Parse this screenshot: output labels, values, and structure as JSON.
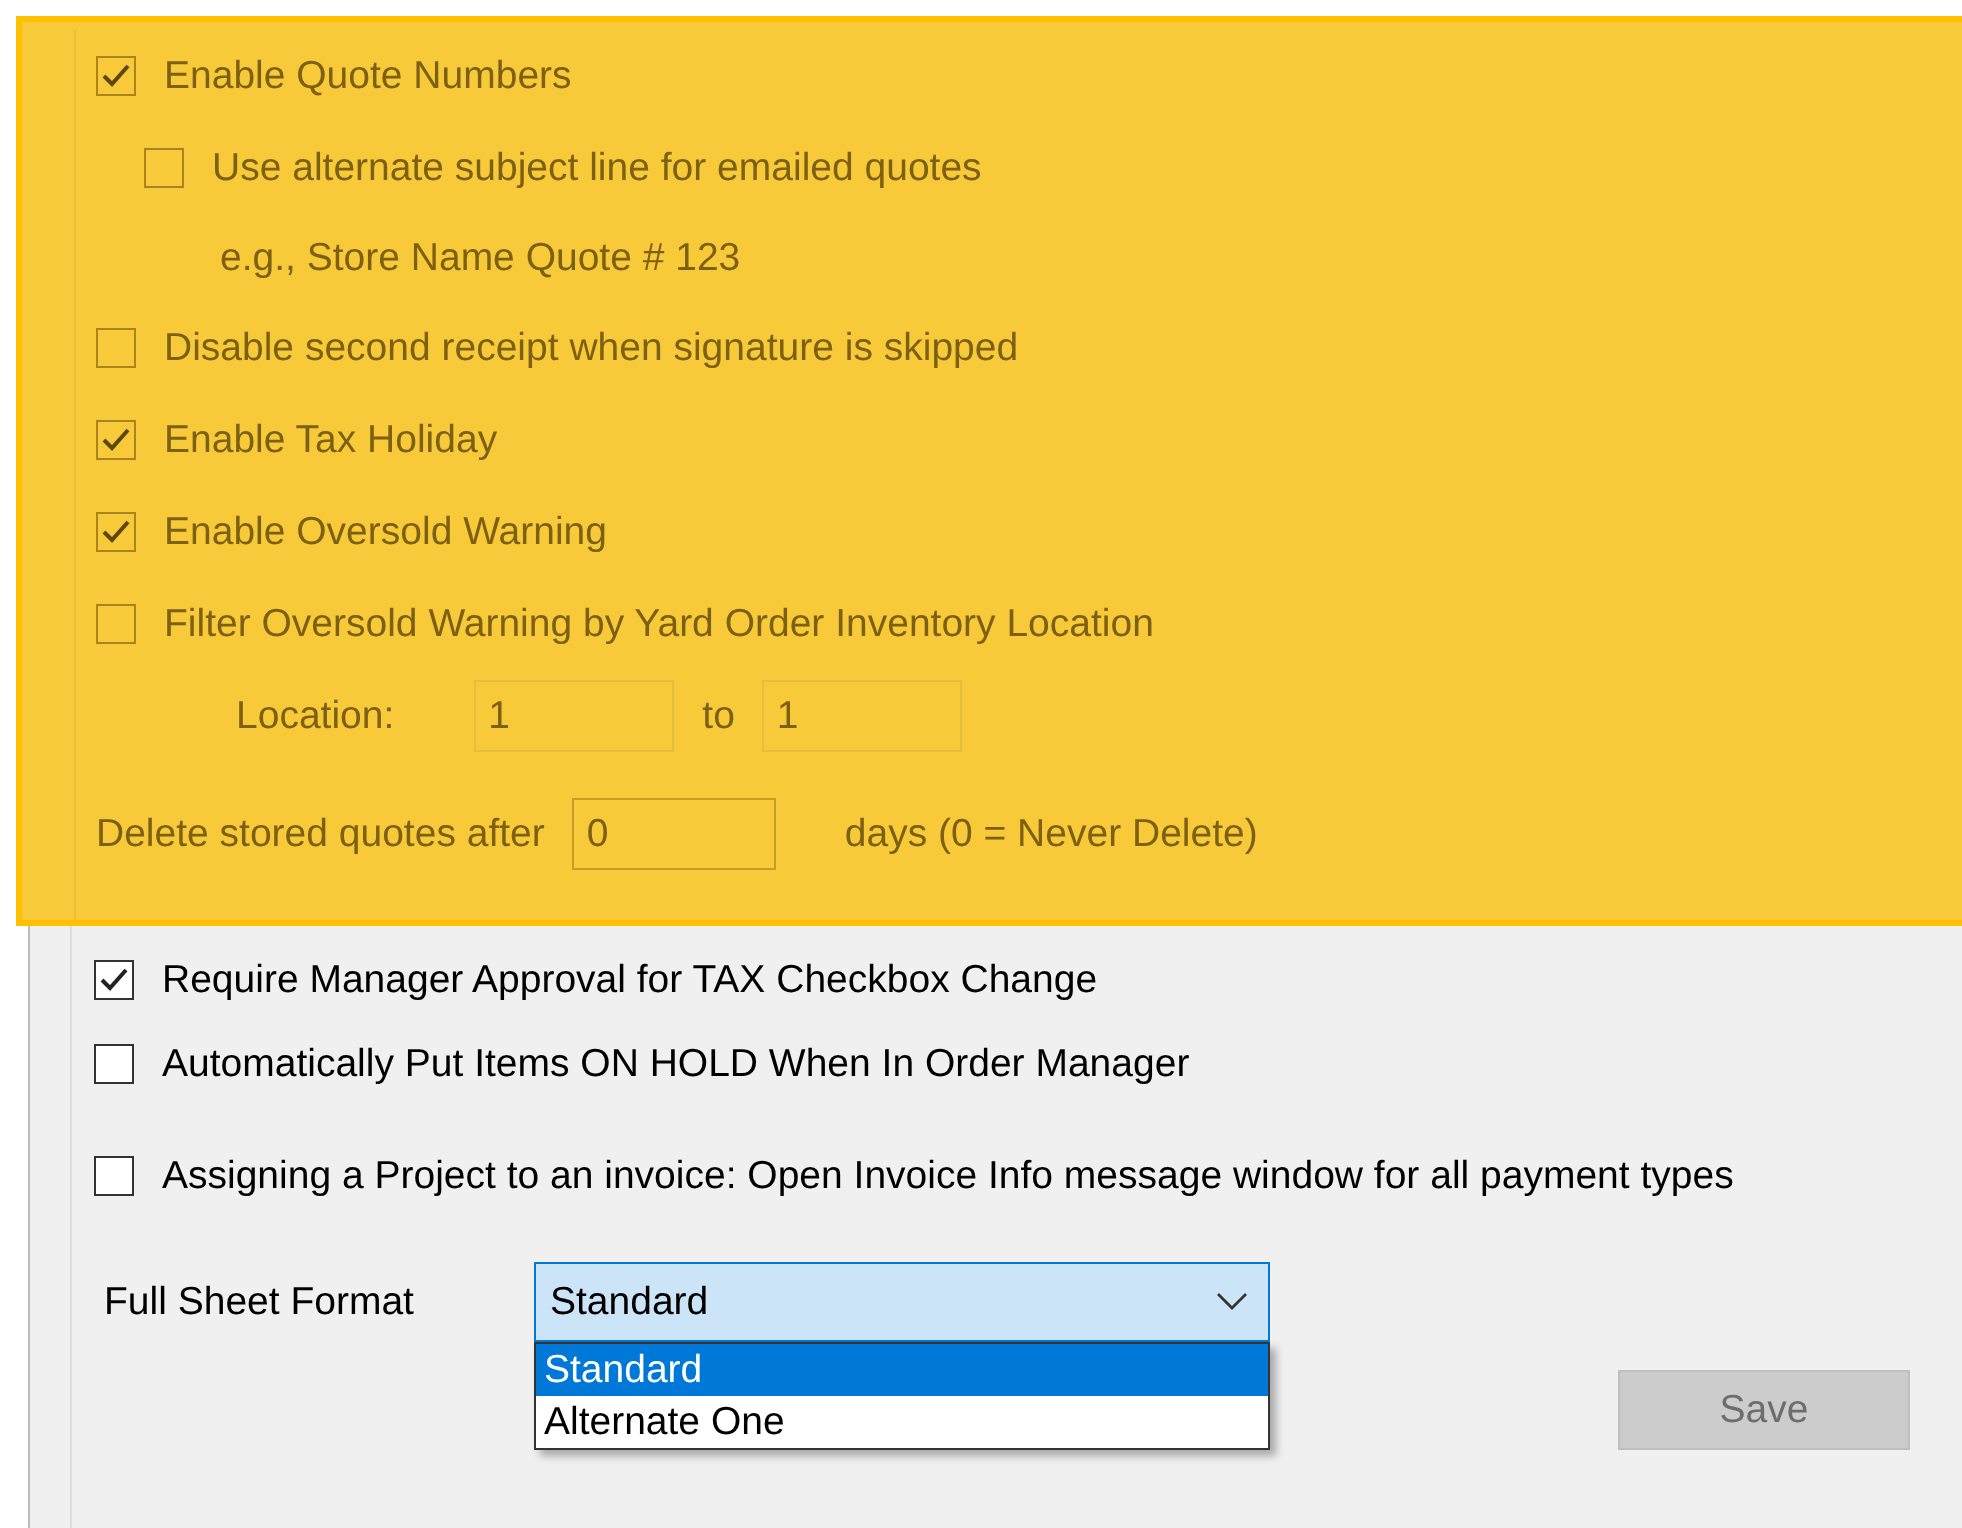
{
  "highlighted_section": {
    "items": [
      {
        "kind": "checkbox",
        "label": "Enable Quote Numbers",
        "checked": true,
        "children": [
          {
            "kind": "checkbox",
            "label": "Use alternate subject line for emailed quotes",
            "checked": false
          },
          {
            "kind": "note",
            "label": "e.g., Store Name Quote # 123"
          }
        ]
      },
      {
        "kind": "checkbox",
        "label": "Disable second receipt when signature is skipped",
        "checked": false
      },
      {
        "kind": "checkbox",
        "label": "Enable Tax Holiday",
        "checked": true
      },
      {
        "kind": "checkbox",
        "label": "Enable Oversold Warning",
        "checked": true
      },
      {
        "kind": "checkbox",
        "label": "Filter Oversold Warning by Yard Order Inventory Location",
        "checked": false
      },
      {
        "kind": "range",
        "label": "Location:",
        "from": "1",
        "separator": "to",
        "to": "1"
      },
      {
        "kind": "number_field",
        "label": "Delete stored quotes after",
        "value": "0",
        "suffix": "days (0 = Never Delete)"
      }
    ]
  },
  "option_groups": [
    [
      {
        "label": "Require Manager Approval for TAX Checkbox Change",
        "checked": true
      },
      {
        "label": "Automatically Put Items ON HOLD When In Order Manager",
        "checked": false
      }
    ],
    [
      {
        "label": "Assigning a Project to an invoice: Open Invoice Info message window for all payment types",
        "checked": false
      }
    ]
  ],
  "full_sheet_format": {
    "label": "Full Sheet Format",
    "value": "Standard",
    "expanded": true,
    "options": [
      {
        "label": "Standard",
        "selected": true
      },
      {
        "label": "Alternate One",
        "selected": false
      }
    ]
  },
  "save_button": {
    "label": "Save",
    "disabled": true
  }
}
